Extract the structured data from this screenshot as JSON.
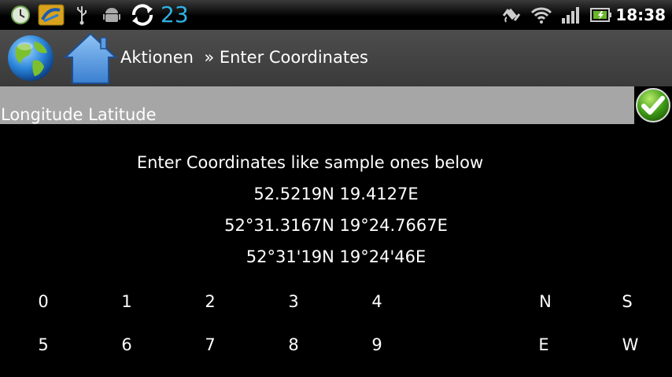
{
  "status_bar": {
    "notification_count": "23",
    "time": "18:38",
    "icons": [
      "clock-icon",
      "sync-app-icon",
      "usb-icon",
      "android-debug-icon",
      "sync-icon",
      "gps-icon",
      "wifi-icon",
      "signal-icon",
      "battery-icon"
    ]
  },
  "action_bar": {
    "breadcrumb": "Aktionen  » Enter Coordinates",
    "icons": [
      "globe-icon",
      "home-icon"
    ]
  },
  "input": {
    "value": "Longitude Latitude"
  },
  "instructions": {
    "header": "Enter Coordinates like sample ones below",
    "sample_decimal": "52.5219N 19.4127E",
    "sample_decimal_minutes": "52°31.3167N 19°24.7667E",
    "sample_dms": "52°31'19N 19°24'46E"
  },
  "keypad": {
    "row1": [
      "0",
      "1",
      "2",
      "3",
      "4",
      "N",
      "S"
    ],
    "row2": [
      "5",
      "6",
      "7",
      "8",
      "9",
      "E",
      "W"
    ]
  },
  "colors": {
    "accent": "#2fb3e6",
    "field_bg": "#a6a6a6",
    "confirm_green": "#3e9a16"
  }
}
